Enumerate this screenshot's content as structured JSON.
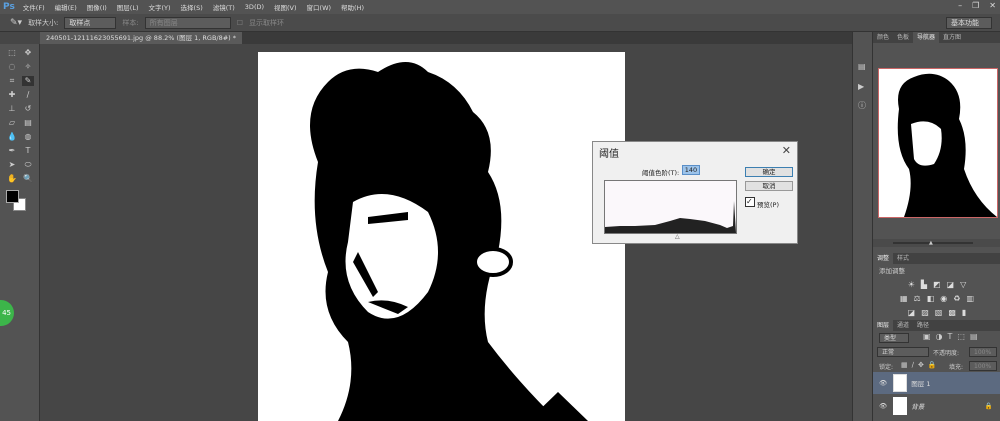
{
  "menubar": {
    "logo": "Ps",
    "items": [
      "文件(F)",
      "编辑(E)",
      "图像(I)",
      "图层(L)",
      "文字(Y)",
      "选择(S)",
      "滤镜(T)",
      "3D(D)",
      "视图(V)",
      "窗口(W)",
      "帮助(H)"
    ]
  },
  "options": {
    "sample_size_label": "取样大小:",
    "sample_size_value": "取样点",
    "sample_label": "样本:",
    "sample_value": "所有图层",
    "show_ring": "显示取样环",
    "workspace": "基本功能"
  },
  "document": {
    "tab": "240501-12111623055691.jpg @ 88.2% (图层 1, RGB/8#) *"
  },
  "badge": "45",
  "dialog": {
    "title": "阈值",
    "level_label": "阈值色阶(T):",
    "level_value": "140",
    "ok": "确定",
    "cancel": "取消",
    "preview_label": "预览(P)",
    "preview_checked": true
  },
  "panels": {
    "top_tabs": [
      "颜色",
      "色板",
      "导航器",
      "直方图"
    ],
    "active_top": "导航器",
    "adj_tabs": [
      "调整",
      "样式"
    ],
    "adj_add": "添加调整",
    "layers_tabs": [
      "图层",
      "通道",
      "路径"
    ],
    "kind": "类型",
    "blend": "正常",
    "opacity_label": "不透明度:",
    "opacity": "100%",
    "lock_label": "锁定:",
    "fill_label": "填充:",
    "fill": "100%",
    "layers": [
      {
        "name": "图层 1",
        "selected": true
      },
      {
        "name": "背景",
        "selected": false
      }
    ]
  }
}
